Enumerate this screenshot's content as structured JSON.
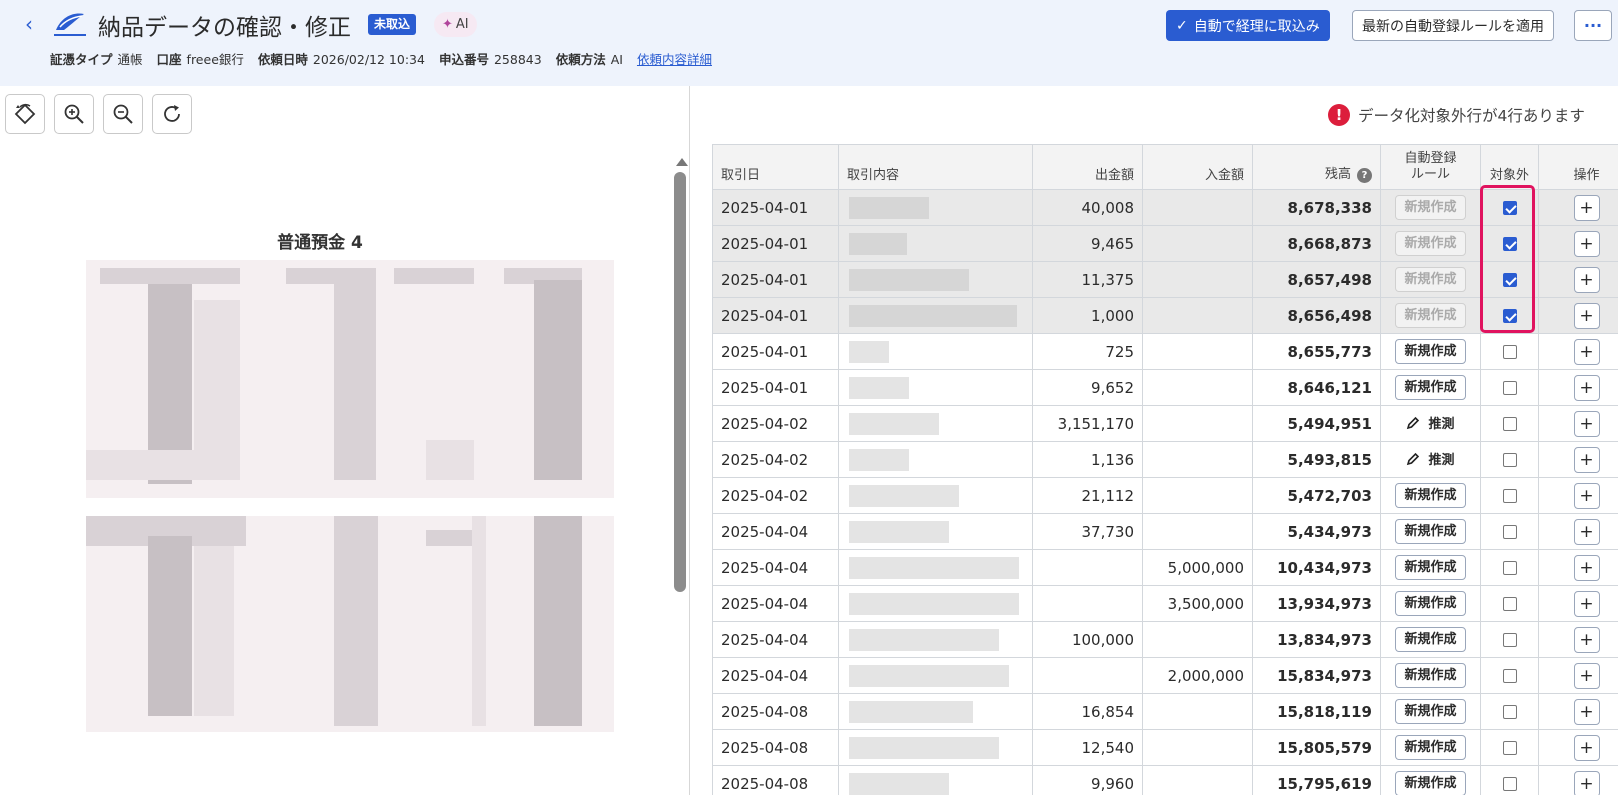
{
  "header": {
    "title": "納品データの確認・修正",
    "status_badge": "未取込",
    "ai_badge": "AI",
    "meta": [
      {
        "label": "証憑タイプ",
        "value": "通帳"
      },
      {
        "label": "口座",
        "value": "freee銀行"
      },
      {
        "label": "依頼日時",
        "value": "2026/02/12 10:34"
      },
      {
        "label": "申込番号",
        "value": "258843"
      },
      {
        "label": "依頼方法",
        "value": "AI"
      }
    ],
    "detail_link": "依頼内容詳細",
    "primary_button": "自動で経理に取込み",
    "secondary_button": "最新の自動登録ルールを適用",
    "more_button": "···"
  },
  "viewer": {
    "tools": [
      "rotate-icon",
      "zoom-in-icon",
      "zoom-out-icon",
      "refresh-icon"
    ],
    "document_title": "普通預金 4"
  },
  "warning": {
    "text": "データ化対象外行が4行あります",
    "color": "#dc1e3c"
  },
  "table": {
    "headers": {
      "date": "取引日",
      "description": "取引内容",
      "withdrawal": "出金額",
      "deposit": "入金額",
      "balance": "残高",
      "rule_line1": "自動登録",
      "rule_line2": "ルール",
      "excluded": "対象外",
      "operation": "操作"
    },
    "rows": [
      {
        "date": "2025-04-01",
        "withdrawal": "40,008",
        "deposit": "",
        "balance": "8,678,338",
        "rule": "新規作成",
        "rule_state": "disabled",
        "excluded": true
      },
      {
        "date": "2025-04-01",
        "withdrawal": "9,465",
        "deposit": "",
        "balance": "8,668,873",
        "rule": "新規作成",
        "rule_state": "disabled",
        "excluded": true
      },
      {
        "date": "2025-04-01",
        "withdrawal": "11,375",
        "deposit": "",
        "balance": "8,657,498",
        "rule": "新規作成",
        "rule_state": "disabled",
        "excluded": true
      },
      {
        "date": "2025-04-01",
        "withdrawal": "1,000",
        "deposit": "",
        "balance": "8,656,498",
        "rule": "新規作成",
        "rule_state": "disabled",
        "excluded": true
      },
      {
        "date": "2025-04-01",
        "withdrawal": "725",
        "deposit": "",
        "balance": "8,655,773",
        "rule": "新規作成",
        "rule_state": "new",
        "excluded": false
      },
      {
        "date": "2025-04-01",
        "withdrawal": "9,652",
        "deposit": "",
        "balance": "8,646,121",
        "rule": "新規作成",
        "rule_state": "new",
        "excluded": false
      },
      {
        "date": "2025-04-02",
        "withdrawal": "3,151,170",
        "deposit": "",
        "balance": "5,494,951",
        "rule": "推測",
        "rule_state": "guess",
        "excluded": false
      },
      {
        "date": "2025-04-02",
        "withdrawal": "1,136",
        "deposit": "",
        "balance": "5,493,815",
        "rule": "推測",
        "rule_state": "guess",
        "excluded": false
      },
      {
        "date": "2025-04-02",
        "withdrawal": "21,112",
        "deposit": "",
        "balance": "5,472,703",
        "rule": "新規作成",
        "rule_state": "new",
        "excluded": false
      },
      {
        "date": "2025-04-04",
        "withdrawal": "37,730",
        "deposit": "",
        "balance": "5,434,973",
        "rule": "新規作成",
        "rule_state": "new",
        "excluded": false
      },
      {
        "date": "2025-04-04",
        "withdrawal": "",
        "deposit": "5,000,000",
        "balance": "10,434,973",
        "rule": "新規作成",
        "rule_state": "new",
        "excluded": false
      },
      {
        "date": "2025-04-04",
        "withdrawal": "",
        "deposit": "3,500,000",
        "balance": "13,934,973",
        "rule": "新規作成",
        "rule_state": "new",
        "excluded": false
      },
      {
        "date": "2025-04-04",
        "withdrawal": "100,000",
        "deposit": "",
        "balance": "13,834,973",
        "rule": "新規作成",
        "rule_state": "new",
        "excluded": false
      },
      {
        "date": "2025-04-04",
        "withdrawal": "",
        "deposit": "2,000,000",
        "balance": "15,834,973",
        "rule": "新規作成",
        "rule_state": "new",
        "excluded": false
      },
      {
        "date": "2025-04-08",
        "withdrawal": "16,854",
        "deposit": "",
        "balance": "15,818,119",
        "rule": "新規作成",
        "rule_state": "new",
        "excluded": false
      },
      {
        "date": "2025-04-08",
        "withdrawal": "12,540",
        "deposit": "",
        "balance": "15,805,579",
        "rule": "新規作成",
        "rule_state": "new",
        "excluded": false
      },
      {
        "date": "2025-04-08",
        "withdrawal": "9,960",
        "deposit": "",
        "balance": "15,795,619",
        "rule": "新規作成",
        "rule_state": "new",
        "excluded": false
      }
    ]
  },
  "colors": {
    "accent": "#2a5cd1",
    "highlight": "#e0135f",
    "header_bg": "#eef3fc"
  }
}
